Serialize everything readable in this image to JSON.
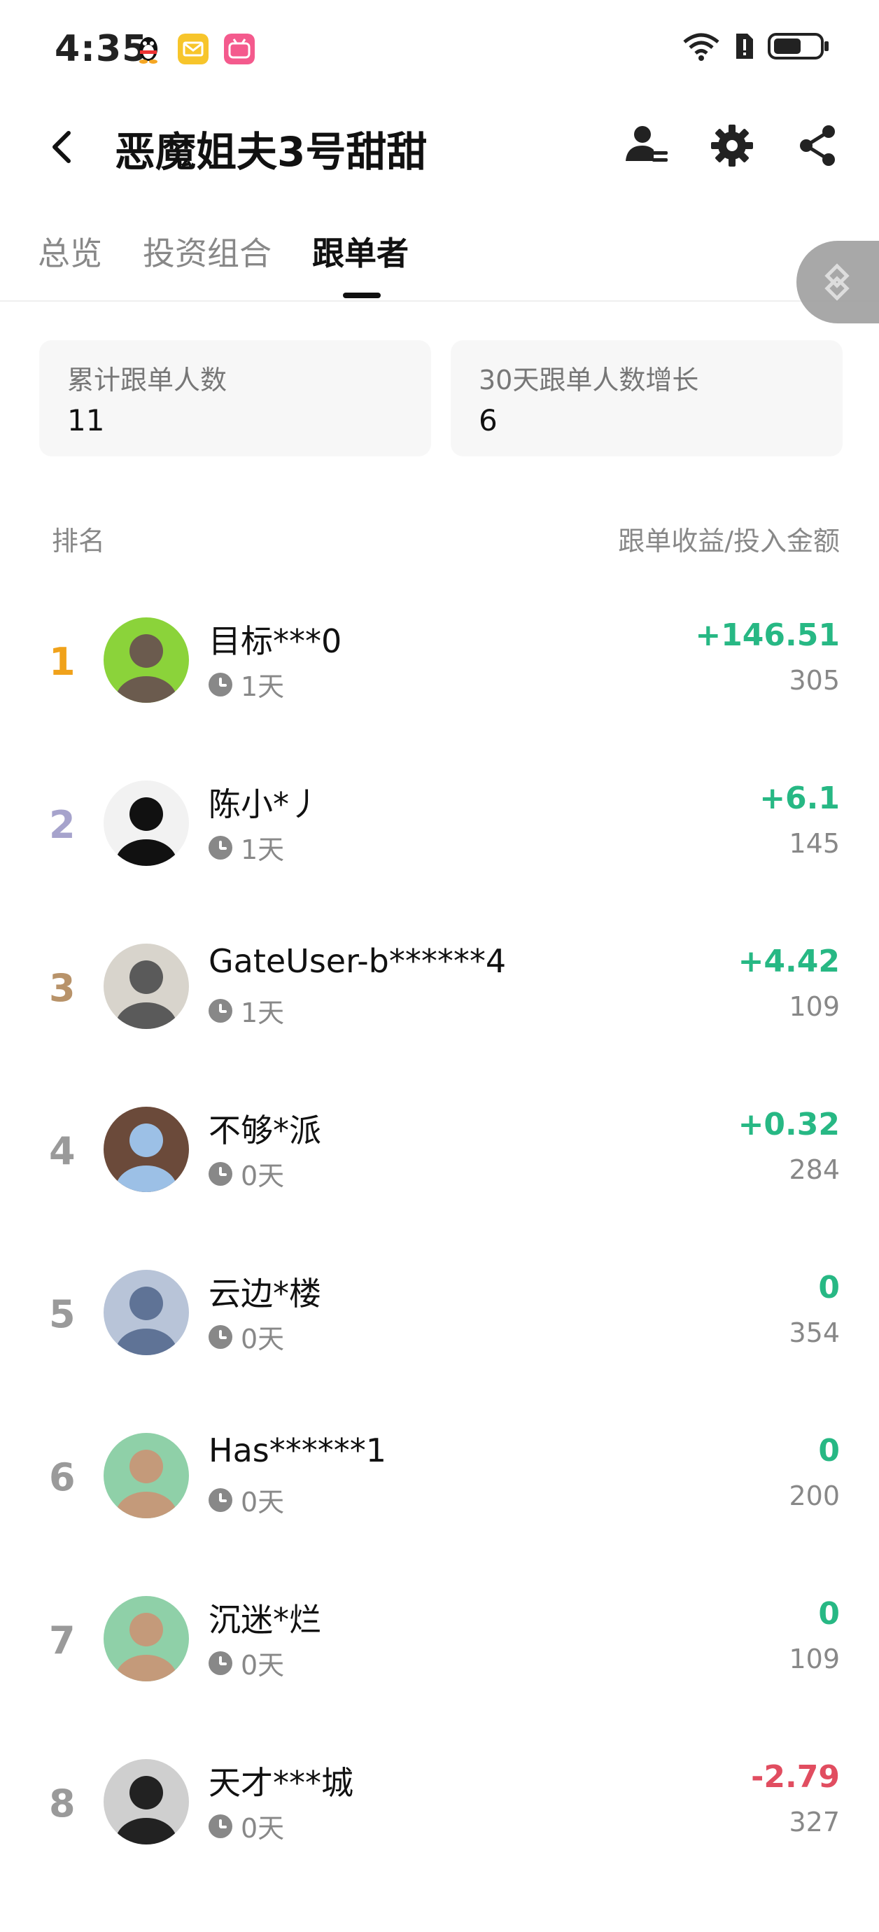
{
  "status": {
    "time": "4:35"
  },
  "header": {
    "title": "恶魔姐夫3号甜甜"
  },
  "tabs": [
    {
      "label": "总览"
    },
    {
      "label": "投资组合"
    },
    {
      "label": "跟单者"
    }
  ],
  "active_tab": 2,
  "stats": [
    {
      "label": "累计跟单人数",
      "value": "11"
    },
    {
      "label": "30天跟单人数增长",
      "value": "6"
    }
  ],
  "list_header": {
    "left": "排名",
    "right": "跟单收益/投入金额"
  },
  "colors": {
    "gold": "#F0A21B",
    "silver": "#A6A3CC",
    "bronze": "#B8936A",
    "gray_rank": "#9A9A9A",
    "green": "#27B884",
    "red": "#E14D60"
  },
  "followers": [
    {
      "rank": "1",
      "name": "目标***0",
      "days": "1天",
      "pnl": "+146.51",
      "amount": "305"
    },
    {
      "rank": "2",
      "name": "陈小*丿",
      "days": "1天",
      "pnl": "+6.1",
      "amount": "145"
    },
    {
      "rank": "3",
      "name": "GateUser-b******4",
      "days": "1天",
      "pnl": "+4.42",
      "amount": "109"
    },
    {
      "rank": "4",
      "name": "不够*派",
      "days": "0天",
      "pnl": "+0.32",
      "amount": "284"
    },
    {
      "rank": "5",
      "name": "云边*楼",
      "days": "0天",
      "pnl": "0",
      "amount": "354"
    },
    {
      "rank": "6",
      "name": "Has******1",
      "days": "0天",
      "pnl": "0",
      "amount": "200"
    },
    {
      "rank": "7",
      "name": "沉迷*烂",
      "days": "0天",
      "pnl": "0",
      "amount": "109"
    },
    {
      "rank": "8",
      "name": "天才***城",
      "days": "0天",
      "pnl": "-2.79",
      "amount": "327"
    }
  ]
}
